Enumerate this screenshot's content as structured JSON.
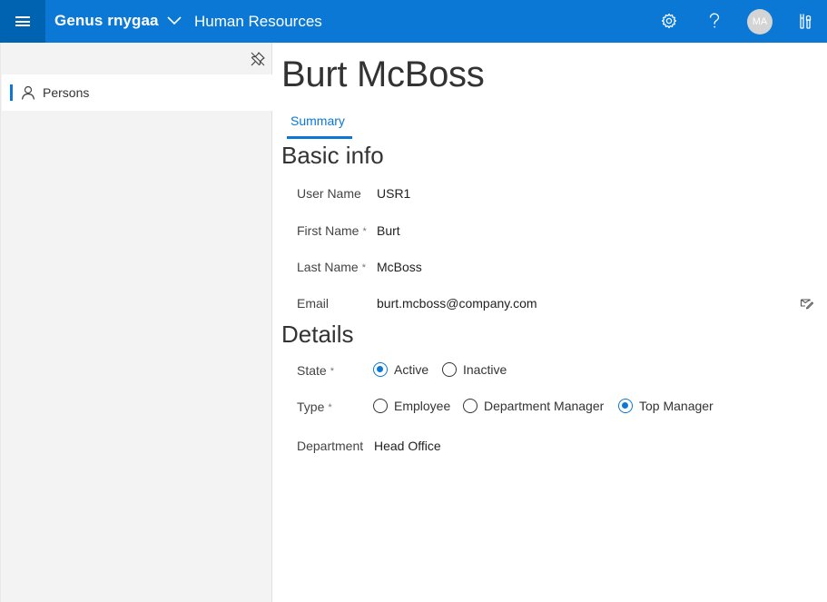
{
  "header": {
    "app_title": "Genus rnygaa",
    "module": "Human Resources",
    "avatar_initials": "MA",
    "icons": [
      "menu-icon",
      "chevron-down-icon",
      "gear-icon",
      "help-icon",
      "avatar",
      "tools-icon"
    ],
    "colors": {
      "bar": "#0a78d4",
      "menu_button": "#0063b1"
    }
  },
  "sidebar": {
    "items": [
      {
        "label": "Persons",
        "icon": "person-icon",
        "selected": true
      }
    ]
  },
  "main": {
    "title": "Burt McBoss",
    "tabs": [
      {
        "label": "Summary",
        "active": true
      }
    ],
    "basic_info": {
      "title": "Basic info",
      "fields": [
        {
          "label": "User Name",
          "value": "USR1",
          "required": false
        },
        {
          "label": "First Name",
          "value": "Burt",
          "required": true
        },
        {
          "label": "Last Name",
          "value": "McBoss",
          "required": true
        },
        {
          "label": "Email",
          "value": "burt.mcboss@company.com",
          "required": false
        }
      ]
    },
    "details": {
      "title": "Details",
      "state": {
        "label": "State",
        "required": true,
        "options": [
          {
            "label": "Active",
            "checked": true
          },
          {
            "label": "Inactive",
            "checked": false
          }
        ]
      },
      "type": {
        "label": "Type",
        "required": true,
        "options": [
          {
            "label": "Employee",
            "checked": false
          },
          {
            "label": "Department Manager",
            "checked": false
          },
          {
            "label": "Top Manager",
            "checked": true
          }
        ]
      },
      "department": {
        "label": "Department",
        "value": "Head Office"
      }
    },
    "required_marker": "*"
  }
}
